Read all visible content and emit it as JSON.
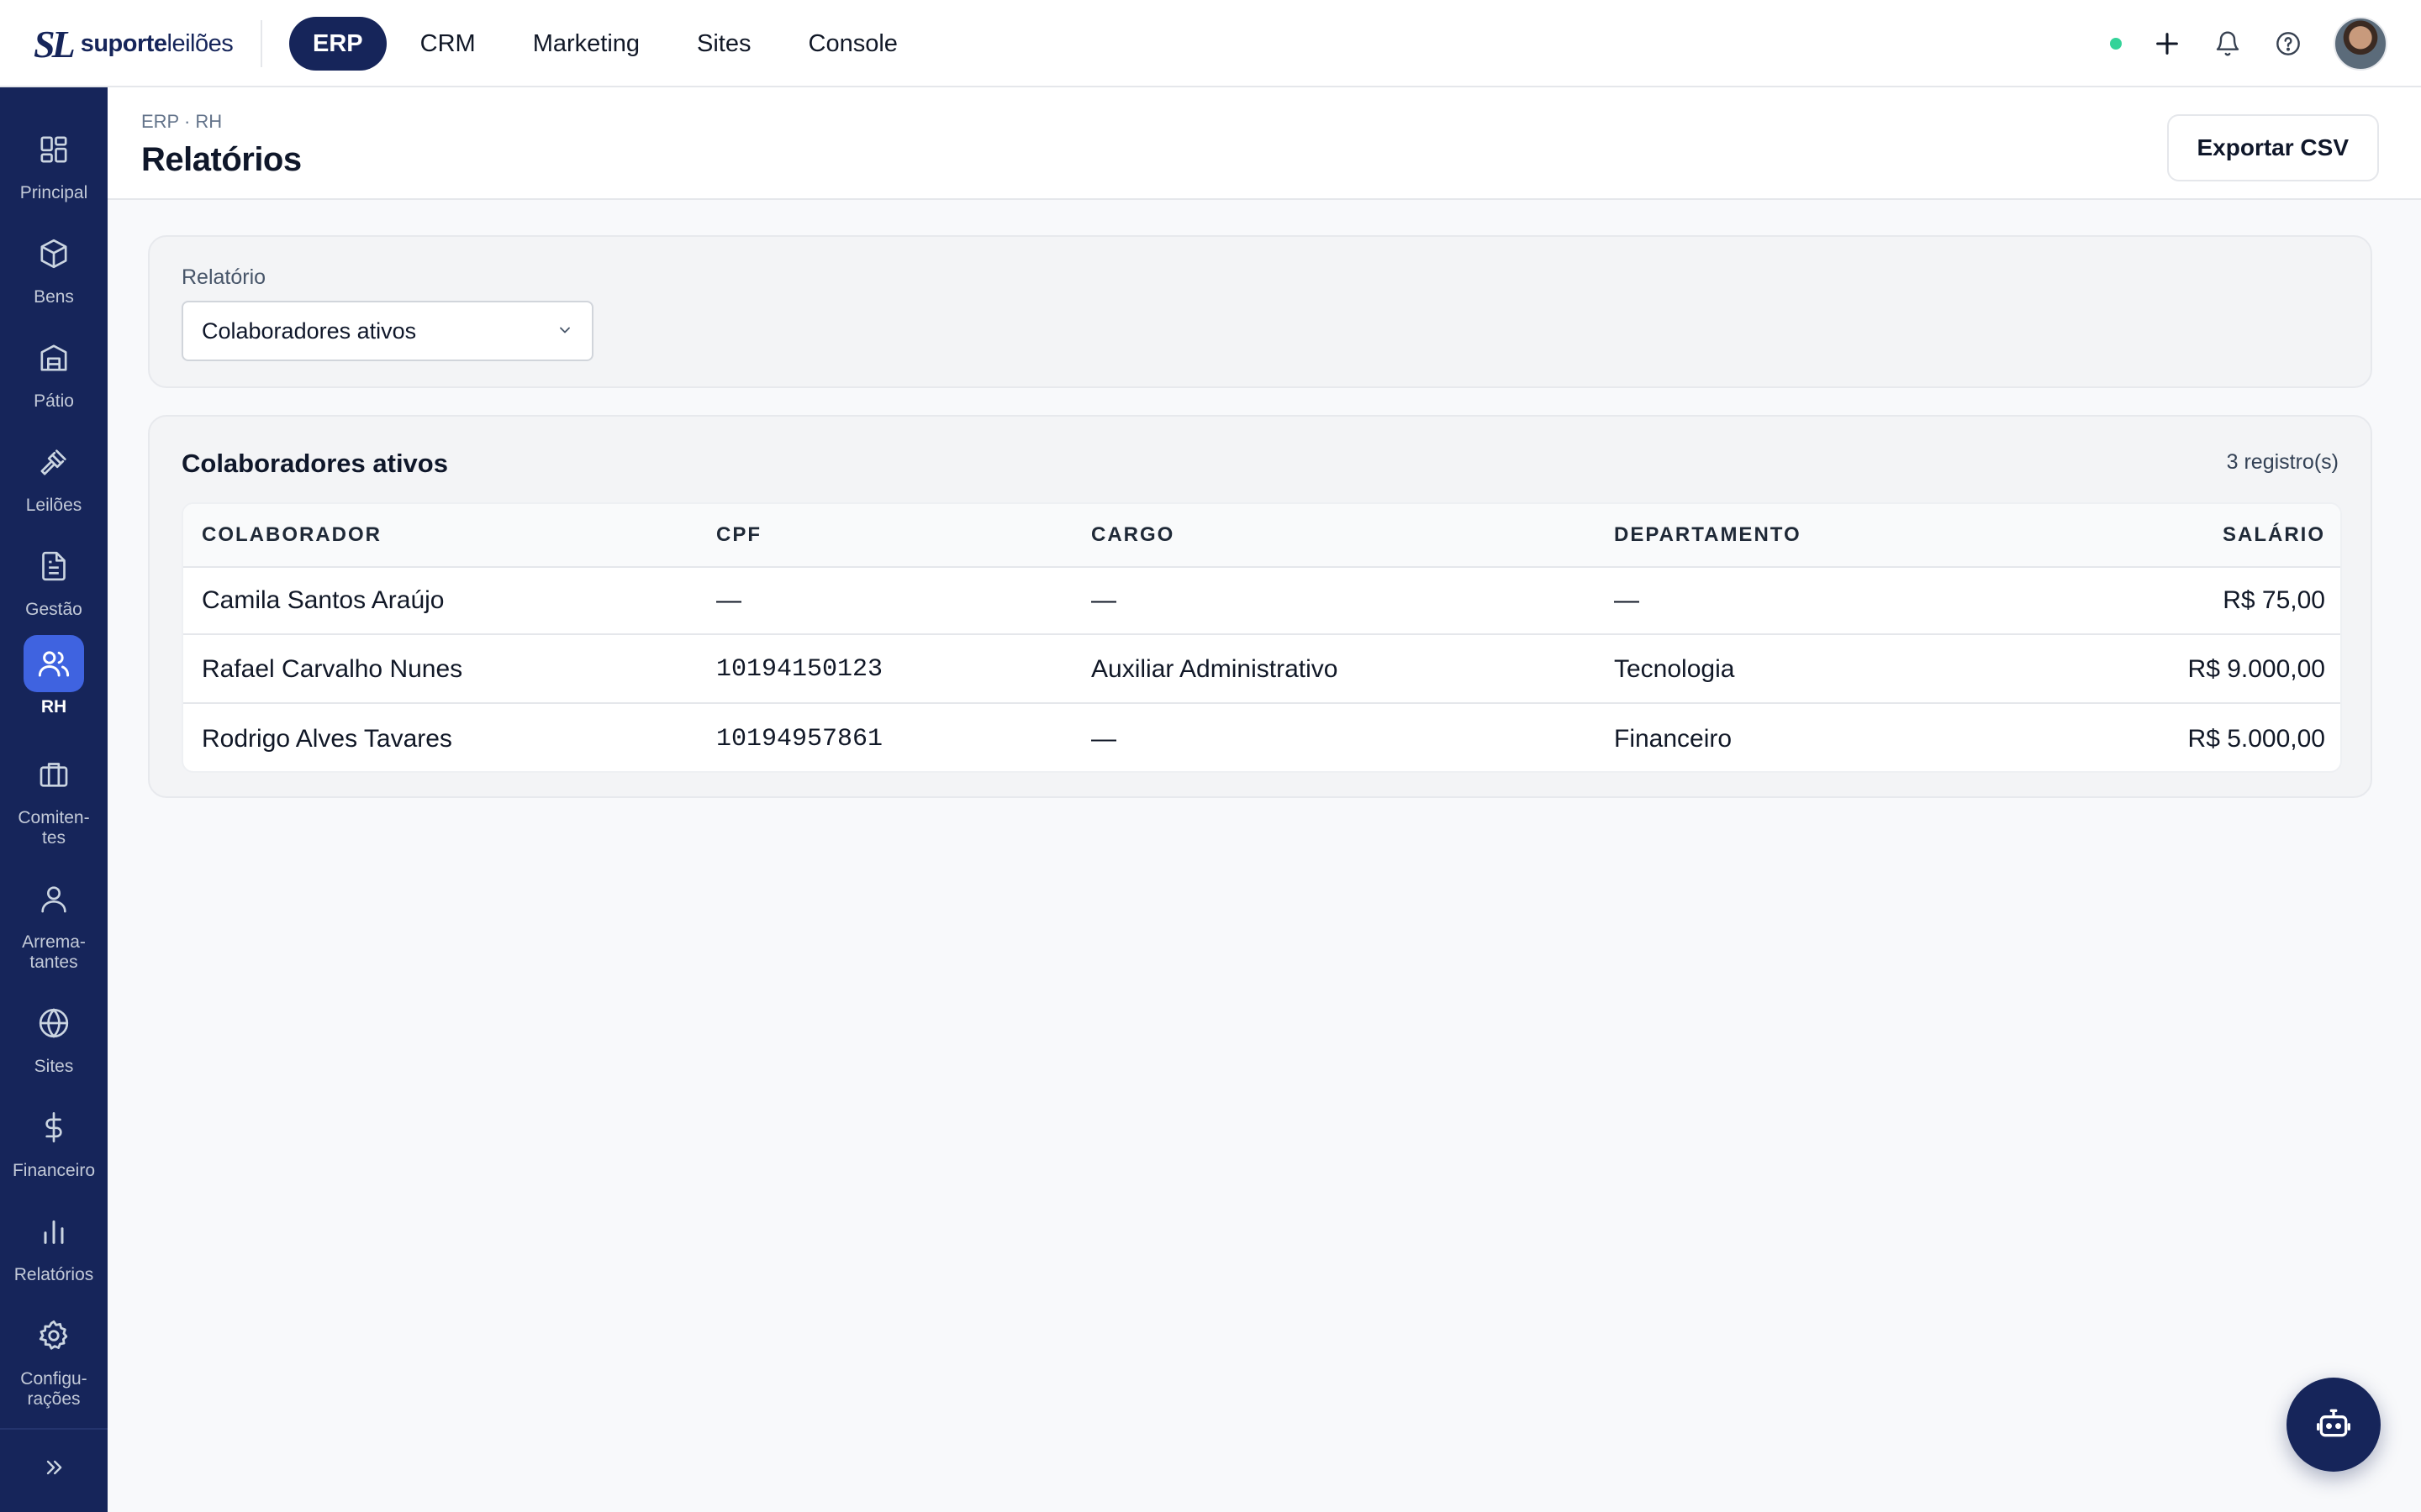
{
  "brand": {
    "mark": "SL",
    "name_bold": "suporte",
    "name_light": "leilões"
  },
  "topnav": {
    "items": [
      {
        "label": "ERP",
        "active": true
      },
      {
        "label": "CRM",
        "active": false
      },
      {
        "label": "Marketing",
        "active": false
      },
      {
        "label": "Sites",
        "active": false
      },
      {
        "label": "Console",
        "active": false
      }
    ]
  },
  "top_actions": {
    "icons": [
      "status-dot",
      "plus-icon",
      "bell-icon",
      "help-icon",
      "avatar"
    ]
  },
  "sidebar": {
    "items": [
      {
        "label": "Principal",
        "icon": "grid-icon"
      },
      {
        "label": "Bens",
        "icon": "box-icon"
      },
      {
        "label": "Pátio",
        "icon": "warehouse-icon"
      },
      {
        "label": "Leilões",
        "icon": "gavel-icon"
      },
      {
        "label": "Gestão",
        "icon": "document-icon"
      },
      {
        "label": "RH",
        "icon": "users-icon",
        "active": true
      },
      {
        "label": "Comiten-\ntes",
        "icon": "briefcase-icon"
      },
      {
        "label": "Arrema-\ntantes",
        "icon": "user-icon"
      },
      {
        "label": "Sites",
        "icon": "globe-icon"
      },
      {
        "label": "Financeiro",
        "icon": "dollar-icon"
      },
      {
        "label": "Relatórios",
        "icon": "bar-chart-icon"
      },
      {
        "label": "Configu-\nrações",
        "icon": "gear-icon"
      }
    ],
    "collapse_icon": "chevrons-right-icon"
  },
  "header": {
    "breadcrumb": "ERP · RH",
    "title": "Relatórios",
    "export_label": "Exportar CSV"
  },
  "filter": {
    "label": "Relatório",
    "selected": "Colaboradores ativos"
  },
  "report": {
    "title": "Colaboradores ativos",
    "count": "3 registro(s)",
    "columns": [
      "COLABORADOR",
      "CPF",
      "CARGO",
      "DEPARTAMENTO",
      "SALÁRIO"
    ],
    "rows": [
      [
        "Camila Santos Araújo",
        "—",
        "—",
        "—",
        "R$ 75,00"
      ],
      [
        "Rafael Carvalho Nunes",
        "10194150123",
        "Auxiliar Administrativo",
        "Tecnologia",
        "R$ 9.000,00"
      ],
      [
        "Rodrigo Alves Tavares",
        "10194957861",
        "—",
        "Financeiro",
        "R$ 5.000,00"
      ]
    ]
  },
  "colors": {
    "navy": "#16255a",
    "accent": "#3f63e0",
    "online": "#34d399"
  }
}
